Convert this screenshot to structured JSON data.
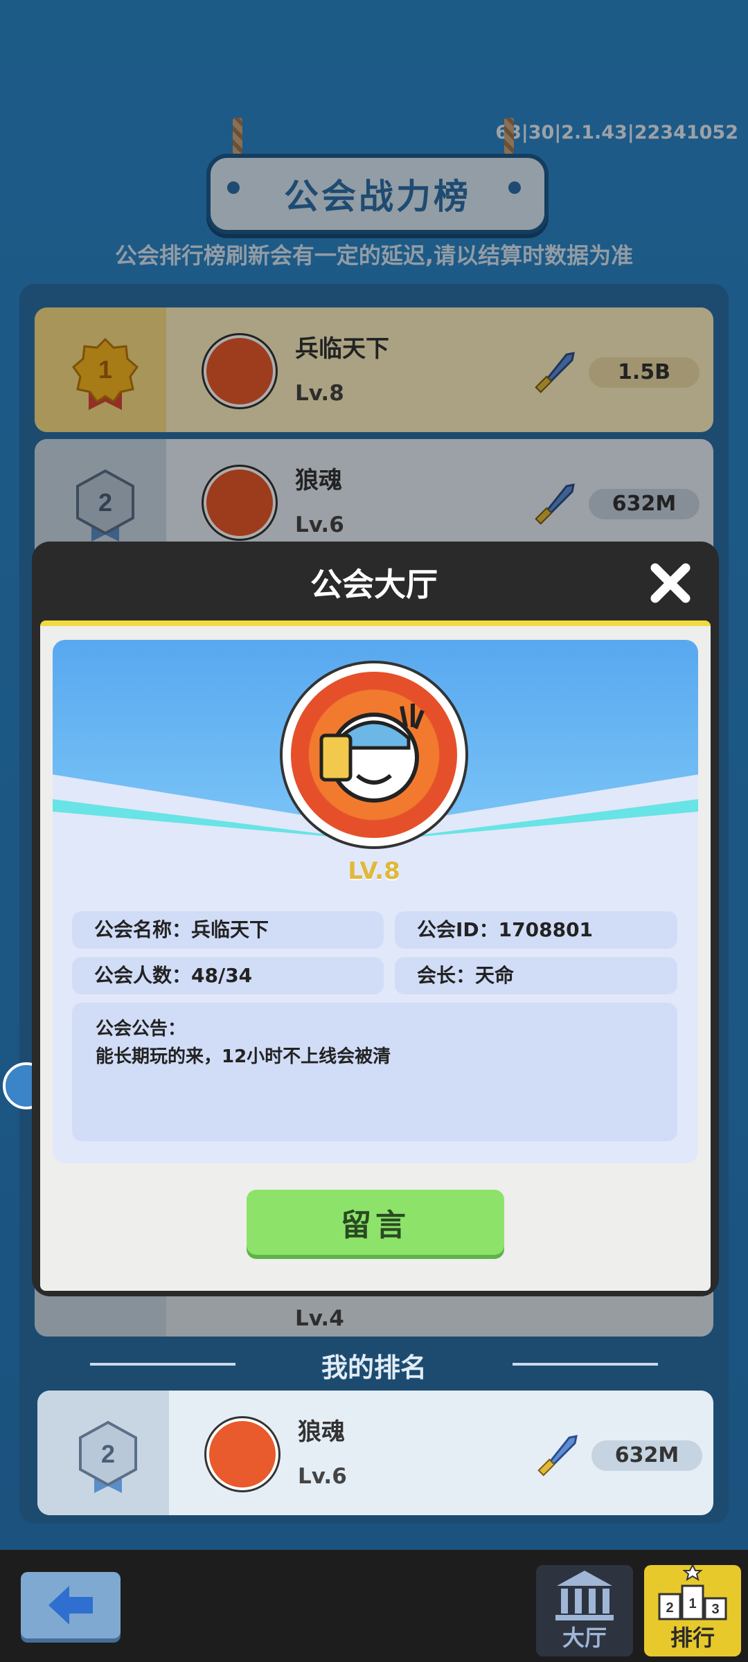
{
  "version": "63|30|2.1.43|22341052",
  "title": "公会战力榜",
  "subtitle": "公会排行榜刷新会有一定的延迟,请以结算时数据为准",
  "ranking": [
    {
      "rank": "1",
      "name": "兵临天下",
      "level": "Lv.8",
      "power": "1.5B"
    },
    {
      "rank": "2",
      "name": "狼魂",
      "level": "Lv.6",
      "power": "632M"
    }
  ],
  "behind_level": "Lv.4",
  "modal": {
    "title": "公会大厅",
    "emblem_level": "LV.8",
    "guild_name_field": "公会名称：兵临天下",
    "guild_id_field": "公会ID：1708801",
    "members_field": "公会人数：48/34",
    "leader_field": "会长：天命",
    "notice_title": "公会公告：",
    "notice_text": "能长期玩的来，12小时不上线会被清",
    "message_button": "留言"
  },
  "my_rank": {
    "label": "我的排名",
    "rank": "2",
    "name": "狼魂",
    "level": "Lv.6",
    "power": "632M"
  },
  "footer": {
    "hall_label": "大厅",
    "rank_label": "排行"
  },
  "colors": {
    "background": "#2a7fc1",
    "gold_row": "#fbefc0",
    "modal_header": "#2a2a2a",
    "accent_yellow": "#f1d940",
    "button_green": "#8de36a"
  }
}
